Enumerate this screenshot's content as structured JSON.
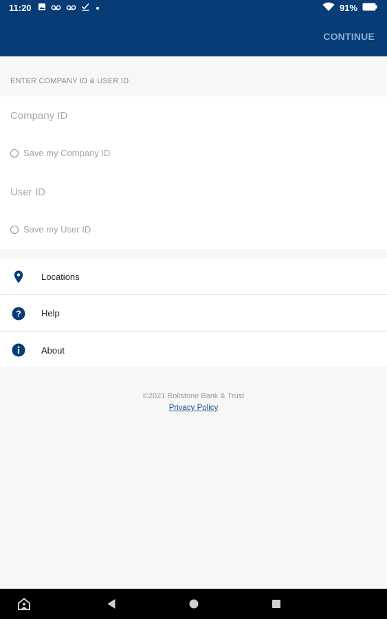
{
  "status_bar": {
    "time": "11:20",
    "battery": "91%",
    "icons": [
      "image-icon",
      "voicemail-icon",
      "voicemail-icon",
      "check-icon",
      "dot-icon",
      "wifi-icon",
      "battery-icon"
    ]
  },
  "app_bar": {
    "continue_label": "CONTINUE"
  },
  "login": {
    "section_header": "ENTER COMPANY ID & USER ID",
    "company_id_placeholder": "Company ID",
    "save_company_label": "Save my Company ID",
    "user_id_placeholder": "User ID",
    "save_user_label": "Save my User ID"
  },
  "menu": {
    "items": [
      {
        "label": "Locations",
        "icon": "location-pin-icon"
      },
      {
        "label": "Help",
        "icon": "help-icon"
      },
      {
        "label": "About",
        "icon": "info-icon"
      }
    ]
  },
  "footer": {
    "copyright": "©2021 Rollstone Bank & Trust",
    "privacy_label": "Privacy Policy"
  },
  "colors": {
    "primary": "#073c77",
    "continue_text": "#8fb0d6",
    "link": "#1e4b86",
    "background": "#f7f7f7"
  }
}
